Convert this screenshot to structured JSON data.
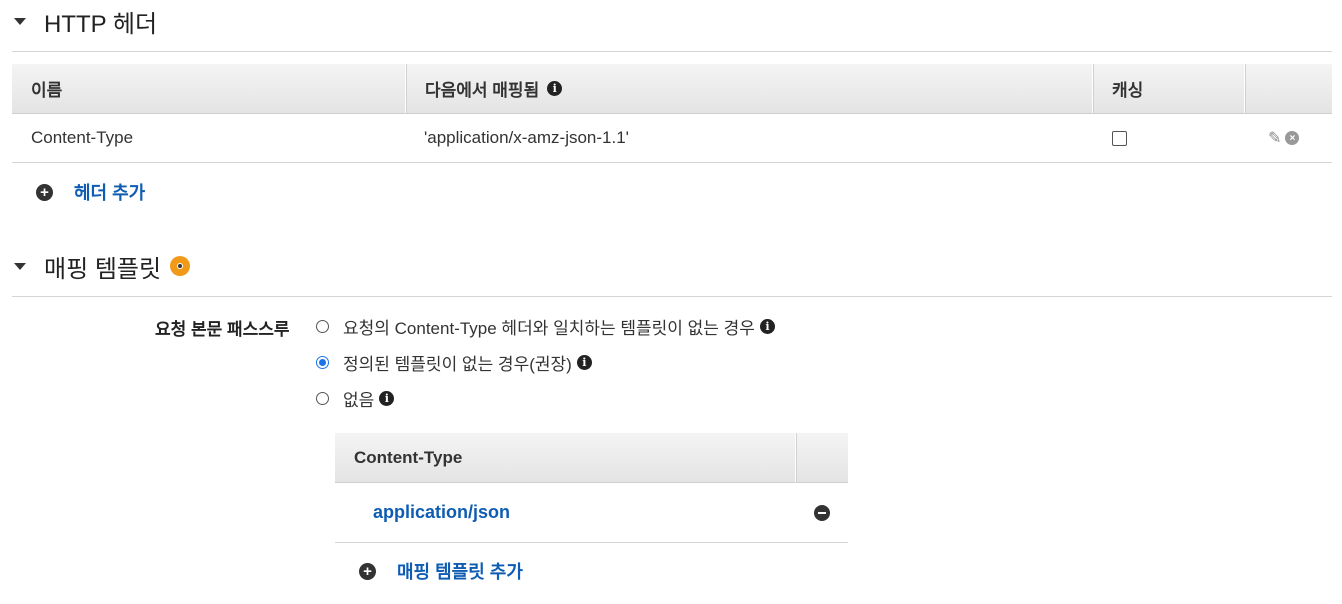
{
  "http_headers": {
    "title": "HTTP 헤더",
    "columns": {
      "name": "이름",
      "mapped_from": "다음에서 매핑됨",
      "caching": "캐싱"
    },
    "rows": [
      {
        "name": "Content-Type",
        "mapped_from": "'application/x-amz-json-1.1'",
        "caching": false
      }
    ],
    "add_label": "헤더 추가"
  },
  "mapping_templates": {
    "title": "매핑 템플릿",
    "passthrough_label": "요청 본문 패스스루",
    "options": [
      {
        "label": "요청의 Content-Type 헤더와 일치하는 템플릿이 없는 경우",
        "selected": false
      },
      {
        "label": "정의된 템플릿이 없는 경우(권장)",
        "selected": true
      },
      {
        "label": "없음",
        "selected": false
      }
    ],
    "table_header": "Content-Type",
    "rows": [
      {
        "content_type": "application/json"
      }
    ],
    "add_label": "매핑 템플릿 추가"
  },
  "icons": {
    "collapse": "caret-down-icon",
    "info": "info-icon",
    "edit": "pencil-icon",
    "remove": "x-circle-icon",
    "add": "plus-circle-icon",
    "warning": "warning-dot-icon",
    "delete": "minus-circle-icon"
  },
  "colors": {
    "link": "#0f5db2",
    "warning": "#f19a19",
    "radio_selected": "#1a73e8"
  }
}
